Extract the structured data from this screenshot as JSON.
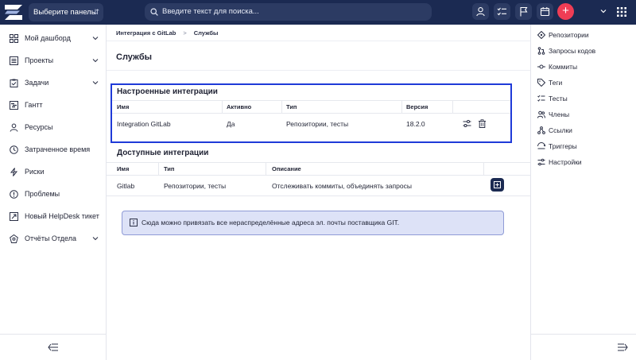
{
  "topbar": {
    "panel_select": "Выберите панель",
    "search_placeholder": "Введите текст для поиска...",
    "colors": {
      "bar": "#1b2a52",
      "accent": "#ef3d55"
    }
  },
  "sidebar": {
    "items": [
      {
        "label": "Мой дашборд",
        "icon": "dashboard-icon",
        "expandable": true
      },
      {
        "label": "Проекты",
        "icon": "list-icon",
        "expandable": true
      },
      {
        "label": "Задачи",
        "icon": "clipboard-icon",
        "expandable": true
      },
      {
        "label": "Гантт",
        "icon": "gantt-icon",
        "expandable": false
      },
      {
        "label": "Ресурсы",
        "icon": "user-icon",
        "expandable": false
      },
      {
        "label": "Затраченное время",
        "icon": "clock-icon",
        "expandable": false
      },
      {
        "label": "Риски",
        "icon": "bolt-icon",
        "expandable": false
      },
      {
        "label": "Проблемы",
        "icon": "alert-icon",
        "expandable": false
      },
      {
        "label": "Новый HelpDesk тикет",
        "icon": "ticket-icon",
        "expandable": false
      },
      {
        "label": "Отчёты Отдела",
        "icon": "report-icon",
        "expandable": true
      }
    ]
  },
  "breadcrumb": {
    "parent": "Интеграция с GitLab",
    "current": "Службы"
  },
  "page_title": "Службы",
  "configured": {
    "title": "Настроенные интеграции",
    "headers": [
      "Имя",
      "Активно",
      "Тип",
      "Версия"
    ],
    "rows": [
      {
        "name": "Integration GitLab",
        "active": "Да",
        "type": "Репозитории, тесты",
        "version": "18.2.0"
      }
    ]
  },
  "available": {
    "title": "Доступные интеграции",
    "headers": [
      "Имя",
      "Тип",
      "Описание"
    ],
    "rows": [
      {
        "name": "Gitlab",
        "type": "Репозитории, тесты",
        "description": "Отслеживать коммиты, объединять запросы"
      }
    ]
  },
  "info_message": "Сюда можно привязать все нераспределённые адреса эл. почты поставщика GIT.",
  "right_menu": {
    "items": [
      {
        "label": "Репозитории",
        "icon": "repository-icon"
      },
      {
        "label": "Запросы кодов",
        "icon": "merge-request-icon"
      },
      {
        "label": "Коммиты",
        "icon": "commit-icon"
      },
      {
        "label": "Теги",
        "icon": "tag-icon"
      },
      {
        "label": "Тесты",
        "icon": "tests-icon"
      },
      {
        "label": "Члены",
        "icon": "members-icon"
      },
      {
        "label": "Ссылки",
        "icon": "link-icon"
      },
      {
        "label": "Триггеры",
        "icon": "trigger-icon"
      },
      {
        "label": "Настройки",
        "icon": "settings-icon"
      }
    ]
  }
}
